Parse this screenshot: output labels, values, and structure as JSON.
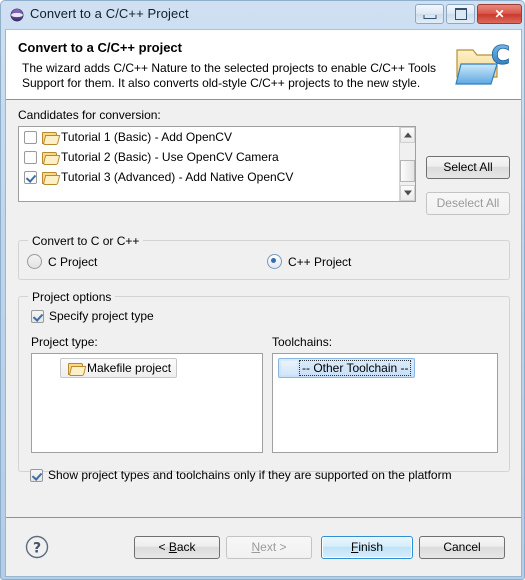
{
  "window": {
    "title": "Convert to a C/C++ Project",
    "app_icon": "eclipse-sphere-icon",
    "controls": {
      "minimize_label": "Minimize",
      "maximize_label": "Maximize",
      "close_label": "✕"
    }
  },
  "header": {
    "title": "Convert to a C/C++ project",
    "description_line1": "The wizard adds C/C++ Nature to the selected projects to enable C/C++ Tools",
    "description_line2": "Support for them. It also converts old-style C/C++ projects to the new style.",
    "icon": "c-project-folder-icon"
  },
  "candidates": {
    "label": "Candidates for conversion:",
    "items": [
      {
        "label": "Tutorial 1 (Basic) - Add OpenCV",
        "checked": false,
        "icon": "folder-icon"
      },
      {
        "label": "Tutorial 2 (Basic) - Use OpenCV Camera",
        "checked": false,
        "icon": "folder-icon"
      },
      {
        "label": "Tutorial 3 (Advanced) - Add Native OpenCV",
        "checked": true,
        "icon": "folder-icon"
      }
    ],
    "select_all_label": "Select All",
    "deselect_all_label": "Deselect All",
    "deselect_all_enabled": false,
    "scrollbar": {
      "up_arrow": "▲",
      "down_arrow": "▼"
    }
  },
  "convert_group": {
    "title": "Convert to C or C++",
    "options": [
      {
        "label": "C Project",
        "selected": false
      },
      {
        "label": "C++ Project",
        "selected": true
      }
    ]
  },
  "project_options": {
    "title": "Project options",
    "specify_project_type": {
      "label": "Specify project type",
      "checked": true
    },
    "project_type": {
      "label": "Project type:",
      "items": [
        {
          "label": "Makefile project",
          "icon": "folder-icon",
          "state": "hover"
        }
      ]
    },
    "toolchains": {
      "label": "Toolchains:",
      "items": [
        {
          "label": "-- Other Toolchain --",
          "state": "selected"
        }
      ]
    },
    "show_supported": {
      "label": "Show project types and toolchains only if they are supported on the platform",
      "checked": true
    }
  },
  "footer": {
    "help_icon": "help-question-icon",
    "buttons": [
      {
        "label": "< Back",
        "enabled": true,
        "default": false
      },
      {
        "label": "Next >",
        "enabled": false,
        "default": false
      },
      {
        "label": "Finish",
        "enabled": true,
        "default": true
      },
      {
        "label": "Cancel",
        "enabled": true,
        "default": false
      }
    ]
  },
  "colors": {
    "title_bar": "#bcd4ec",
    "dialog_bg": "#f0f0f0",
    "accent_blue": "#3a6ea5",
    "default_button_border": "#2f8fd4",
    "close_button_red": "#c9392c"
  }
}
